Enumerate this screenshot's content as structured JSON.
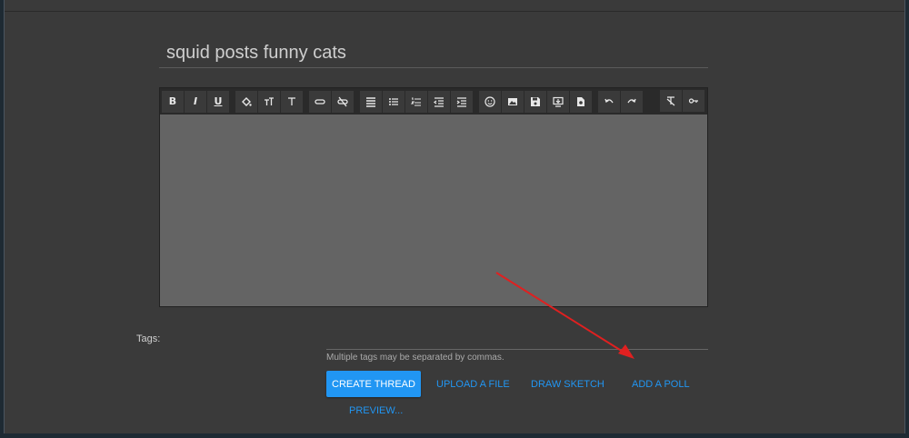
{
  "title_field": {
    "value": "squid posts funny cats"
  },
  "toolbar": {
    "buttons": [
      {
        "name": "bold-button",
        "glyph": "B"
      },
      {
        "name": "italic-button",
        "glyph": "I"
      },
      {
        "name": "underline-button",
        "glyph": "U"
      }
    ]
  },
  "tags": {
    "label": "Tags:",
    "hint": "Multiple tags may be separated by commas."
  },
  "actions": {
    "create_thread": "CREATE THREAD",
    "upload_file": "UPLOAD A FILE",
    "draw_sketch": "DRAW SKETCH",
    "add_poll": "ADD A POLL",
    "preview": "PREVIEW..."
  },
  "colors": {
    "accent": "#2196f3",
    "annotation_arrow": "#e02020"
  }
}
